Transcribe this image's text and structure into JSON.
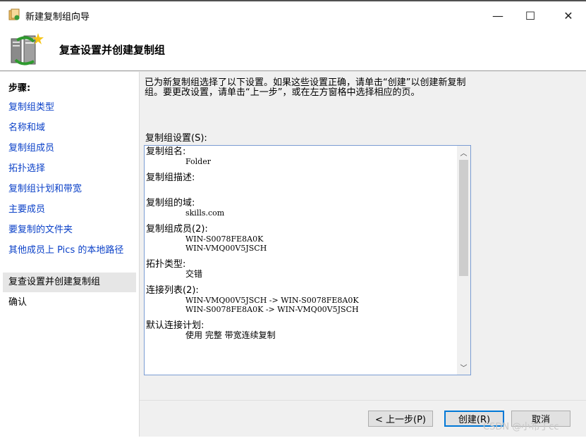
{
  "window": {
    "title": "新建复制组向导",
    "controls": {
      "minimize": "—",
      "maximize": "☐",
      "close": "✕"
    }
  },
  "header": {
    "title": "复查设置并创建复制组",
    "icon": "servers-wizard-icon"
  },
  "sidebar": {
    "heading": "步骤:",
    "items": [
      {
        "label": "复制组类型",
        "state": "link"
      },
      {
        "label": "名称和域",
        "state": "link"
      },
      {
        "label": "复制组成员",
        "state": "link"
      },
      {
        "label": "拓扑选择",
        "state": "link"
      },
      {
        "label": "复制组计划和带宽",
        "state": "link"
      },
      {
        "label": "主要成员",
        "state": "link"
      },
      {
        "label": "要复制的文件夹",
        "state": "link"
      },
      {
        "label": "其他成员上 Pics 的本地路径",
        "state": "link"
      },
      {
        "label": "复查设置并创建复制组",
        "state": "active"
      },
      {
        "label": "确认",
        "state": "plain"
      }
    ]
  },
  "main": {
    "description": "已为新复制组选择了以下设置。如果这些设置正确，请单击“创建”以创建新复制组。要更改设置，请单击“上一步”，或在左方窗格中选择相应的页。",
    "settings_label": "复制组设置(S):",
    "settings": [
      {
        "label": "复制组名:",
        "values": [
          "Folder"
        ]
      },
      {
        "label": "复制组描述:",
        "values": [
          ""
        ]
      },
      {
        "label": "复制组的域:",
        "values": [
          "skills.com"
        ]
      },
      {
        "label": "复制组成员(2):",
        "values": [
          "WIN-S0078FE8A0K",
          "WIN-VMQ00V5JSCH"
        ]
      },
      {
        "label": "拓扑类型:",
        "values": [
          "交错"
        ]
      },
      {
        "label": "连接列表(2):",
        "values": [
          "WIN-VMQ00V5JSCH -> WIN-S0078FE8A0K",
          "WIN-S0078FE8A0K -> WIN-VMQ00V5JSCH"
        ]
      },
      {
        "label": "默认连接计划:",
        "values": [
          "使用 完整 带宽连续复制"
        ]
      }
    ]
  },
  "buttons": {
    "back": "< 上一步(P)",
    "create": "创建(R)",
    "cancel": "取消"
  },
  "watermark": "CSDN @小布丁cc",
  "colors": {
    "link": "#0b41c8",
    "focus_border": "#0078d7",
    "pane_bg": "#f0f0f0"
  }
}
